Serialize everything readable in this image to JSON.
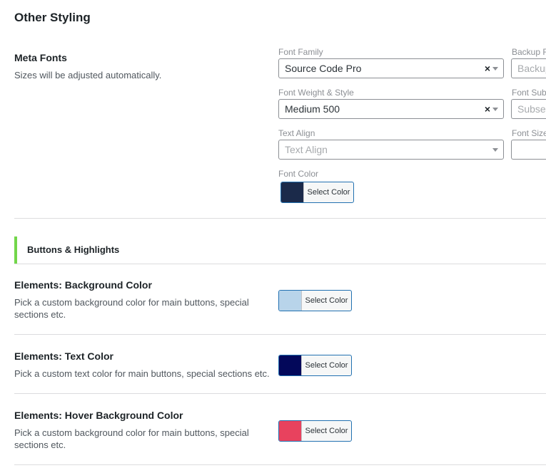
{
  "page_title": "Other Styling",
  "meta_fonts": {
    "title": "Meta Fonts",
    "description": "Sizes will be adjusted automatically.",
    "font_family": {
      "label": "Font Family",
      "value": "Source Code Pro"
    },
    "backup_font": {
      "label": "Backup Fo",
      "placeholder": "Backup"
    },
    "font_weight": {
      "label": "Font Weight & Style",
      "value": "Medium 500"
    },
    "font_subset": {
      "label": "Font Subs",
      "placeholder": "Subset"
    },
    "text_align": {
      "label": "Text Align",
      "placeholder": "Text Align"
    },
    "font_size": {
      "label": "Font Size",
      "value": ""
    },
    "font_color": {
      "label": "Font Color",
      "button": "Select Color",
      "color": "#1b2a4a"
    }
  },
  "section": {
    "label": "Buttons & Highlights",
    "accent": "#72d64a"
  },
  "elements": [
    {
      "title": "Elements: Background Color",
      "description": "Pick a custom background color for main buttons, special sections etc.",
      "button": "Select Color",
      "color": "#b8d4ea"
    },
    {
      "title": "Elements: Text Color",
      "description": "Pick a custom text color for main buttons, special sections etc.",
      "button": "Select Color",
      "color": "#03085a"
    },
    {
      "title": "Elements: Hover Background Color",
      "description": "Pick a custom background color for main buttons, special sections etc.",
      "button": "Select Color",
      "color": "#e8425e"
    }
  ],
  "icons": {
    "clear": "×",
    "dropdown": "chevron-down-icon"
  }
}
